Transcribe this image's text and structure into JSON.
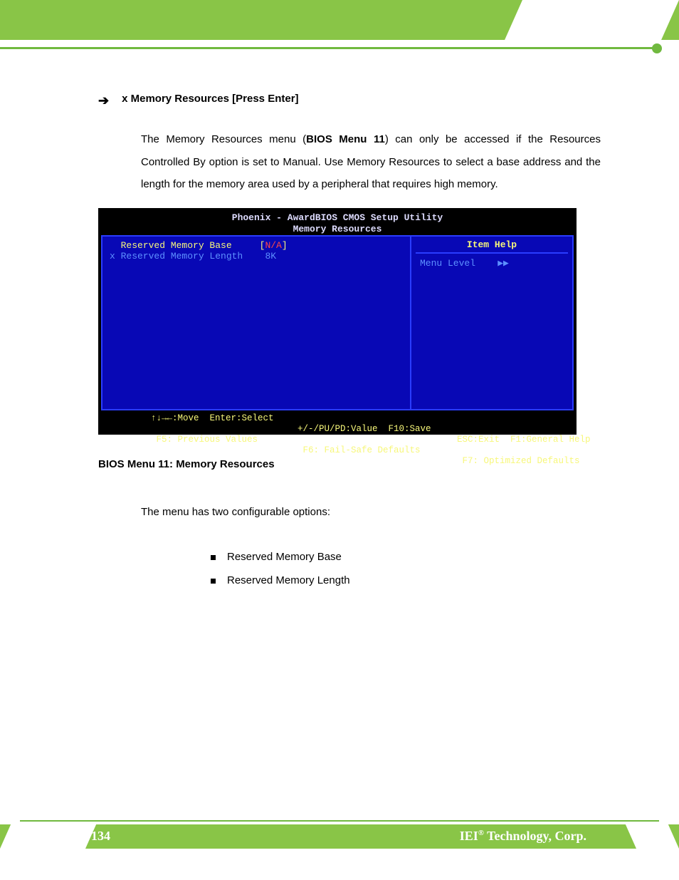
{
  "header": {
    "arrow_glyph": "➔",
    "title": "x Memory Resources [Press Enter]"
  },
  "paragraph": {
    "pre": "The Memory Resources menu (",
    "bold": "BIOS Menu 11",
    "post": ") can only be accessed if the Resources Controlled By option is set to Manual. Use Memory Resources to select a base address and the length for the memory area used by a peripheral that requires high memory."
  },
  "bios": {
    "title_line1": "Phoenix - AwardBIOS CMOS Setup Utility",
    "title_line2": "Memory Resources",
    "row1_label": "  Reserved Memory Base     ",
    "row1_br_open": "[",
    "row1_val": "N/A",
    "row1_br_close": "]",
    "row2_label": "x Reserved Memory Length   ",
    "row2_val": " 8K",
    "item_help": "Item Help",
    "menu_level": "Menu Level    ▶▶",
    "footer_left_1": "↑↓→←:Move  Enter:Select",
    "footer_left_2": " F5: Previous Values",
    "footer_mid_1": "+/-/PU/PD:Value  F10:Save",
    "footer_mid_2": " F6: Fail-Safe Defaults",
    "footer_right_1": "ESC:Exit  F1:General Help",
    "footer_right_2": " F7: Optimized Defaults"
  },
  "caption": "BIOS Menu 11: Memory Resources",
  "lower_para": "The menu has two configurable options:",
  "bullets": [
    "Reserved Memory Base",
    "Reserved Memory Length"
  ],
  "footer": {
    "page_num": "134",
    "company_prefix": "IEI",
    "company_reg": "®",
    "company_suffix": " Technology, Corp."
  }
}
